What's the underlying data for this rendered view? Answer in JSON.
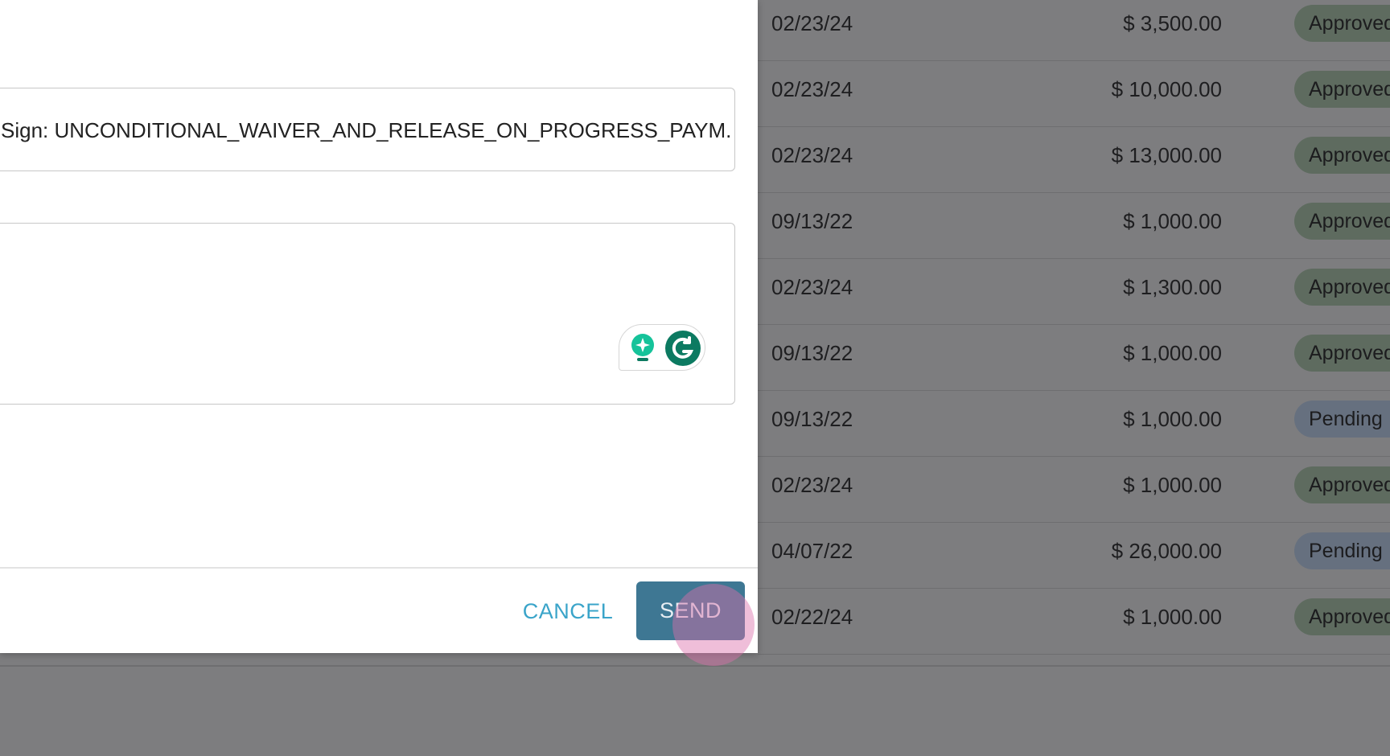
{
  "table": {
    "rows": [
      {
        "date": "02/23/24",
        "amount": "$ 3,500.00",
        "status": "Approved",
        "status_kind": "approved"
      },
      {
        "date": "02/23/24",
        "amount": "$ 10,000.00",
        "status": "Approved",
        "status_kind": "approved"
      },
      {
        "date": "02/23/24",
        "amount": "$ 13,000.00",
        "status": "Approved",
        "status_kind": "approved"
      },
      {
        "date": "09/13/22",
        "amount": "$ 1,000.00",
        "status": "Approved",
        "status_kind": "approved"
      },
      {
        "date": "02/23/24",
        "amount": "$ 1,300.00",
        "status": "Approved",
        "status_kind": "approved"
      },
      {
        "date": "09/13/22",
        "amount": "$ 1,000.00",
        "status": "Approved",
        "status_kind": "approved"
      },
      {
        "date": "09/13/22",
        "amount": "$ 1,000.00",
        "status": "Pending",
        "status_kind": "pending"
      },
      {
        "date": "02/23/24",
        "amount": "$ 1,000.00",
        "status": "Approved",
        "status_kind": "approved"
      },
      {
        "date": "04/07/22",
        "amount": "$ 26,000.00",
        "status": "Pending",
        "status_kind": "pending"
      },
      {
        "date": "02/22/24",
        "amount": "$ 1,000.00",
        "status": "Approved",
        "status_kind": "approved"
      }
    ]
  },
  "modal": {
    "subject_value": "Sign: UNCONDITIONAL_WAIVER_AND_RELEASE_ON_PROGRESS_PAYM.",
    "message_value": "",
    "cancel_label": "CANCEL",
    "send_label": "SEND"
  },
  "colors": {
    "overlay": "#7d7d7f",
    "approved_badge": "#5e6b5f",
    "pending_badge": "#66707f",
    "send_button": "#3e7793",
    "cancel_text": "#3aa4c9",
    "grammarly_green": "#15c39a",
    "grammarly_dark": "#0c7a61"
  },
  "icons": {
    "grammarly_suggestion": "lightbulb-sparkle-icon",
    "grammarly_logo": "grammarly-g-icon"
  }
}
